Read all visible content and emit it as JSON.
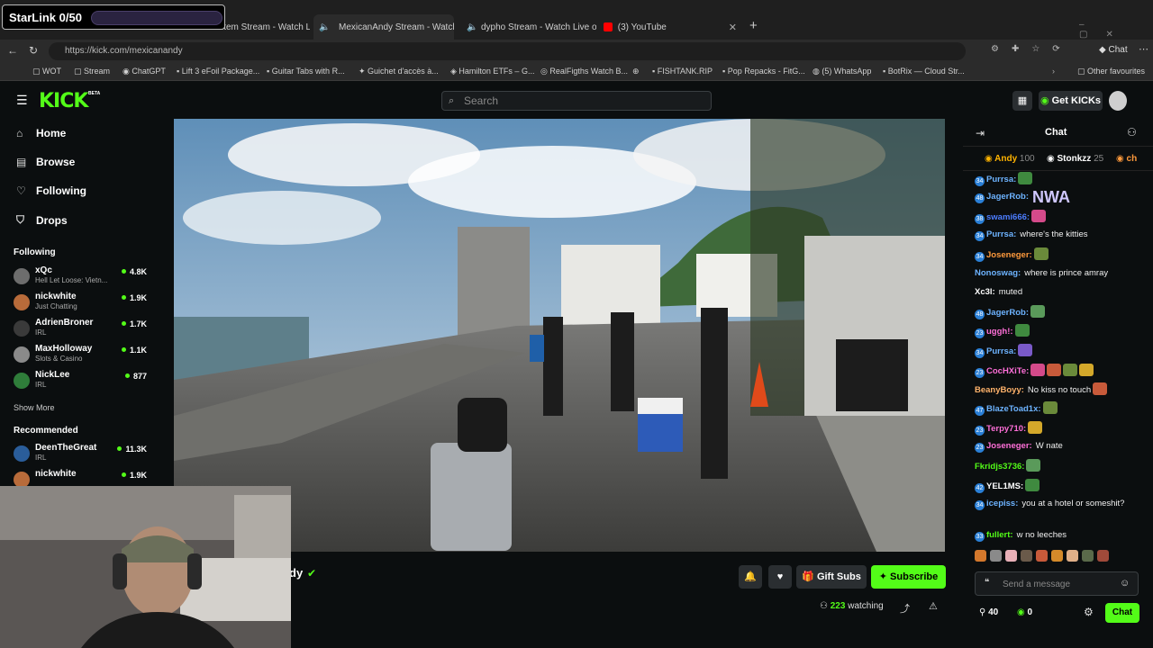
{
  "overlay": {
    "label": "StarLink 0/50",
    "progress": 0.0
  },
  "browser": {
    "tabs": [
      {
        "label": "item Stream - Watch L",
        "active": false
      },
      {
        "label": "MexicanAndy Stream - Watch",
        "active": true
      },
      {
        "label": "dypho Stream - Watch Live o",
        "active": false
      },
      {
        "label": "(3) YouTube",
        "active": false
      }
    ],
    "url": "https://kick.com/mexicanandy",
    "right_label": "Chat",
    "bookmarks": [
      "WOT",
      "Stream",
      "ChatGPT",
      "Lift 3 eFoil Package...",
      "Guitar Tabs with R...",
      "Guichet d'accès à...",
      "Hamilton ETFs – G...",
      "RealFigths Watch B...",
      "FISHTANK.RIP",
      "Pop Repacks - FitG...",
      "(5) WhatsApp",
      "BotRix — Cloud Str...",
      "Other favourites"
    ]
  },
  "kick": {
    "logo": "KICK",
    "beta": "BETA",
    "search_placeholder": "Search",
    "get_kicks": "Get KICKs"
  },
  "sidebar": {
    "nav": [
      {
        "label": "Home",
        "icon": "home-icon"
      },
      {
        "label": "Browse",
        "icon": "browse-icon"
      },
      {
        "label": "Following",
        "icon": "heart-icon"
      },
      {
        "label": "Drops",
        "icon": "drops-icon"
      }
    ],
    "following_title": "Following",
    "following": [
      {
        "name": "xQc",
        "category": "Hell Let Loose: Vietn...",
        "viewers": "4.8K",
        "color": "#6d6d6d"
      },
      {
        "name": "nickwhite",
        "category": "Just Chatting",
        "viewers": "1.9K",
        "color": "#b86b3a"
      },
      {
        "name": "AdrienBroner",
        "category": "IRL",
        "viewers": "1.7K",
        "color": "#3a3a3a"
      },
      {
        "name": "MaxHolloway",
        "category": "Slots & Casino",
        "viewers": "1.1K",
        "color": "#8a8a8a"
      },
      {
        "name": "NickLee",
        "category": "IRL",
        "viewers": "877",
        "color": "#2f7d3a"
      }
    ],
    "show_more": "Show More",
    "recommended_title": "Recommended",
    "recommended": [
      {
        "name": "DeenTheGreat",
        "category": "IRL",
        "viewers": "11.3K",
        "color": "#2a5d9a"
      },
      {
        "name": "nickwhite",
        "category": "Just Chatting",
        "viewers": "1.9K",
        "color": "#b86b3a"
      }
    ]
  },
  "stream": {
    "streamer_fragment": "dy",
    "gift_subs": "Gift Subs",
    "subscribe": "Subscribe",
    "watching_count": "223",
    "watching_label": "watching"
  },
  "chat": {
    "title": "Chat",
    "top_gifters": [
      {
        "name": "Andy",
        "count": "100"
      },
      {
        "name": "Stonkzz",
        "count": "25"
      },
      {
        "name": "ch",
        "count": ""
      }
    ],
    "messages": [
      {
        "badge": "34",
        "user": "Purrsa:",
        "color": "#6db3ff",
        "text": "",
        "emotes": 1
      },
      {
        "badge": "48",
        "user": "JagerRob:",
        "color": "#6db3ff",
        "text": "",
        "emotes": 0,
        "big": "NWA"
      },
      {
        "badge": "38",
        "user": "swami666:",
        "color": "#4c7dff",
        "text": "",
        "emotes": 1
      },
      {
        "badge": "34",
        "user": "Purrsa:",
        "color": "#6db3ff",
        "text": "where's the kitties",
        "emotes": 0
      },
      {
        "badge": "34",
        "user": "Joseneger:",
        "color": "#ff9a3c",
        "text": "",
        "emotes": 1
      },
      {
        "badge": "",
        "user": "Nonoswag:",
        "color": "#6db3ff",
        "text": "where is prince amray",
        "emotes": 0
      },
      {
        "badge": "",
        "user": "Xc3l:",
        "color": "#ffffff",
        "text": "muted",
        "emotes": 0
      },
      {
        "badge": "48",
        "user": "JagerRob:",
        "color": "#6db3ff",
        "text": "",
        "emotes": 1
      },
      {
        "badge": "23",
        "user": "uggh!:",
        "color": "#ff6fd8",
        "text": "",
        "emotes": 1
      },
      {
        "badge": "34",
        "user": "Purrsa:",
        "color": "#6db3ff",
        "text": "",
        "emotes": 1
      },
      {
        "badge": "23",
        "user": "CocHXiTe:",
        "color": "#ff6fd8",
        "text": "",
        "emotes": 4
      },
      {
        "badge": "",
        "user": "BeanyBoyy:",
        "color": "#ffb36b",
        "text": "No kiss no touch",
        "emotes": 1
      },
      {
        "badge": "47",
        "user": "BlazeToad1x:",
        "color": "#6db3ff",
        "text": "",
        "emotes": 1
      },
      {
        "badge": "23",
        "user": "Terpy710:",
        "color": "#ff6fd8",
        "text": "",
        "emotes": 1
      },
      {
        "badge": "23",
        "user": "Joseneger:",
        "color": "#ff6fd8",
        "text": "W nate",
        "emotes": 0
      },
      {
        "badge": "",
        "user": "Fkridjs3736:",
        "color": "#53fc18",
        "text": "",
        "emotes": 1
      },
      {
        "badge": "42",
        "user": "YEL1MS:",
        "color": "#ffffff",
        "text": "",
        "emotes": 1
      },
      {
        "badge": "34",
        "user": "icepiss:",
        "color": "#6db3ff",
        "text": "you at a hotel or someshit?",
        "emotes": 0
      },
      {
        "badge": "33",
        "user": "fullert:",
        "color": "#53fc18",
        "text": "w no leeches",
        "emotes": 0
      }
    ],
    "input_placeholder": "Send a message",
    "points": "40",
    "kicks": "0",
    "chat_button": "Chat"
  }
}
